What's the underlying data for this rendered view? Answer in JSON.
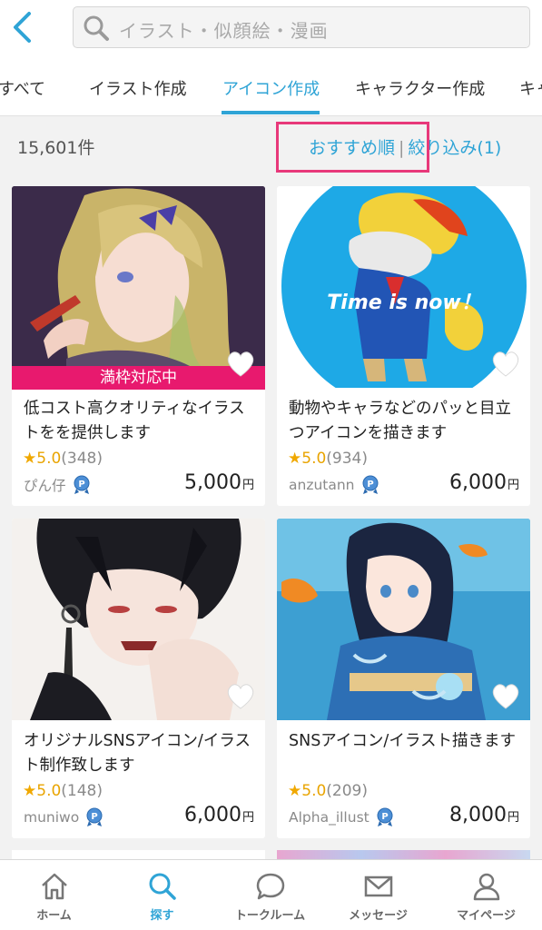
{
  "header": {
    "search_placeholder": "イラスト・似顔絵・漫画"
  },
  "tabs": [
    {
      "label": "すべて"
    },
    {
      "label": "イラスト作成"
    },
    {
      "label": "アイコン作成",
      "active": true
    },
    {
      "label": "キャラクター作成"
    },
    {
      "label": "キャ"
    }
  ],
  "results": {
    "count": "15,601件",
    "sort_label": "おすすめ順",
    "separator": "|",
    "filter_label": "絞り込み(1)"
  },
  "colors": {
    "accent": "#2fa4d6",
    "ribbon": "#e8196e",
    "highlight": "#e8387a",
    "star": "#f0a800"
  },
  "cards": [
    {
      "ribbon": "満枠対応中",
      "title": "低コスト高クオリティなイラストをを提供します",
      "star": "★",
      "score": "5.0",
      "reviews": "(348)",
      "seller": "ぴん仔",
      "price": "5,000",
      "yen": "円"
    },
    {
      "image_text": "Time is now！",
      "title": "動物やキャラなどのパッと目立つアイコンを描きます",
      "star": "★",
      "score": "5.0",
      "reviews": "(934)",
      "seller": "anzutann",
      "price": "6,000",
      "yen": "円"
    },
    {
      "title": "オリジナルSNSアイコン/イラスト制作致します",
      "star": "★",
      "score": "5.0",
      "reviews": "(148)",
      "seller": "muniwo",
      "price": "6,000",
      "yen": "円"
    },
    {
      "title": "SNSアイコン/イラスト描きます",
      "star": "★",
      "score": "5.0",
      "reviews": "(209)",
      "seller": "Alpha_illust",
      "price": "8,000",
      "yen": "円"
    }
  ],
  "bottom_nav": [
    {
      "label": "ホーム",
      "icon": "home-icon"
    },
    {
      "label": "探す",
      "icon": "search-icon",
      "active": true
    },
    {
      "label": "トークルーム",
      "icon": "chat-bubble-icon"
    },
    {
      "label": "メッセージ",
      "icon": "envelope-icon"
    },
    {
      "label": "マイページ",
      "icon": "user-icon"
    }
  ]
}
